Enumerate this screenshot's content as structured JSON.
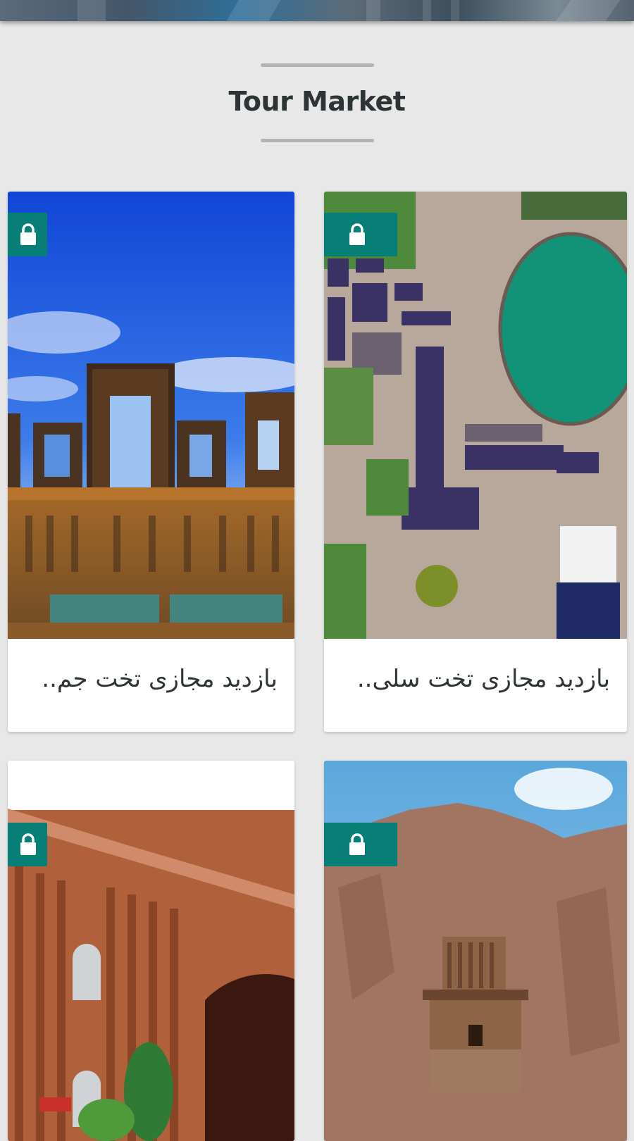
{
  "header": {
    "title": "Tour Market"
  },
  "icons": {
    "lock": "lock-icon",
    "accent_color": "#077f76"
  },
  "tours": [
    {
      "title": "بازدید مجازی تخت جم..",
      "locked": true,
      "scene": "persepolis"
    },
    {
      "title": "بازدید مجازی تخت سلی..",
      "locked": true,
      "scene": "takht-e-soleyman"
    },
    {
      "title": "",
      "locked": true,
      "scene": "national-museum"
    },
    {
      "title": "",
      "locked": true,
      "scene": "naqsh-e-rostam"
    }
  ]
}
